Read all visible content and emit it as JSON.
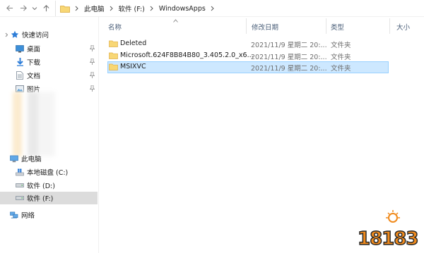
{
  "address": {
    "breadcrumbs": [
      "此电脑",
      "软件 (F:)",
      "WindowsApps"
    ]
  },
  "sidebar": {
    "quick_access": "快速访问",
    "items": [
      {
        "label": "桌面",
        "icon": "desktop-icon",
        "pinned": true
      },
      {
        "label": "下载",
        "icon": "download-icon",
        "pinned": true
      },
      {
        "label": "文档",
        "icon": "document-icon",
        "pinned": true
      },
      {
        "label": "图片",
        "icon": "picture-icon",
        "pinned": true
      }
    ],
    "this_pc": "此电脑",
    "drives": [
      {
        "label": "本地磁盘 (C:)",
        "icon": "drive-icon"
      },
      {
        "label": "软件 (D:)",
        "icon": "drive-icon"
      },
      {
        "label": "软件 (F:)",
        "icon": "drive-icon",
        "selected": true
      }
    ],
    "network": "网络"
  },
  "columns": {
    "name": "名称",
    "modified": "修改日期",
    "type": "类型",
    "size": "大小"
  },
  "files": [
    {
      "name": "Deleted",
      "modified": "2021/11/9 星期二 20:...",
      "type": "文件夹",
      "selected": false
    },
    {
      "name": "Microsoft.624F8B84B80_3.405.2.0_x6...",
      "modified": "2021/11/9 星期二 20:...",
      "type": "文件夹",
      "selected": false
    },
    {
      "name": "MSIXVC",
      "modified": "2021/11/9 星期二 20:...",
      "type": "文件夹",
      "selected": true
    }
  ],
  "watermark": {
    "text": "18183",
    "colors": {
      "orange": "#f08a1c",
      "dark": "#2a2a2a"
    }
  },
  "colors": {
    "folder": "#f8d775",
    "folder_dark": "#e8b84a",
    "selection": "#cde8ff",
    "selection_border": "#99d1ff",
    "sidebar_selected": "#dcdcdc"
  }
}
